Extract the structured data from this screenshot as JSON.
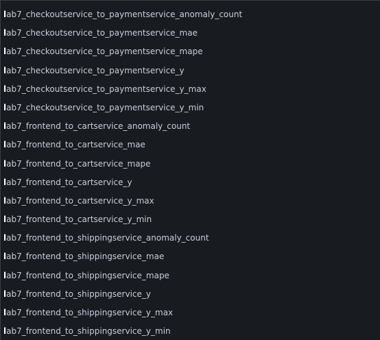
{
  "metric_options": [
    {
      "match": "l",
      "rest": "ab7_checkoutservice_to_paymentservice_anomaly_count"
    },
    {
      "match": "l",
      "rest": "ab7_checkoutservice_to_paymentservice_mae"
    },
    {
      "match": "l",
      "rest": "ab7_checkoutservice_to_paymentservice_mape"
    },
    {
      "match": "l",
      "rest": "ab7_checkoutservice_to_paymentservice_y"
    },
    {
      "match": "l",
      "rest": "ab7_checkoutservice_to_paymentservice_y_max"
    },
    {
      "match": "l",
      "rest": "ab7_checkoutservice_to_paymentservice_y_min"
    },
    {
      "match": "l",
      "rest": "ab7_frontend_to_cartservice_anomaly_count"
    },
    {
      "match": "l",
      "rest": "ab7_frontend_to_cartservice_mae"
    },
    {
      "match": "l",
      "rest": "ab7_frontend_to_cartservice_mape"
    },
    {
      "match": "l",
      "rest": "ab7_frontend_to_cartservice_y"
    },
    {
      "match": "l",
      "rest": "ab7_frontend_to_cartservice_y_max"
    },
    {
      "match": "l",
      "rest": "ab7_frontend_to_cartservice_y_min"
    },
    {
      "match": "l",
      "rest": "ab7_frontend_to_shippingservice_anomaly_count"
    },
    {
      "match": "l",
      "rest": "ab7_frontend_to_shippingservice_mae"
    },
    {
      "match": "l",
      "rest": "ab7_frontend_to_shippingservice_mape"
    },
    {
      "match": "l",
      "rest": "ab7_frontend_to_shippingservice_y"
    },
    {
      "match": "l",
      "rest": "ab7_frontend_to_shippingservice_y_max"
    },
    {
      "match": "l",
      "rest": "ab7_frontend_to_shippingservice_y_min"
    }
  ],
  "colors": {
    "background": "#181b1f",
    "text": "#ccccdc",
    "highlight": "#ffffff"
  }
}
